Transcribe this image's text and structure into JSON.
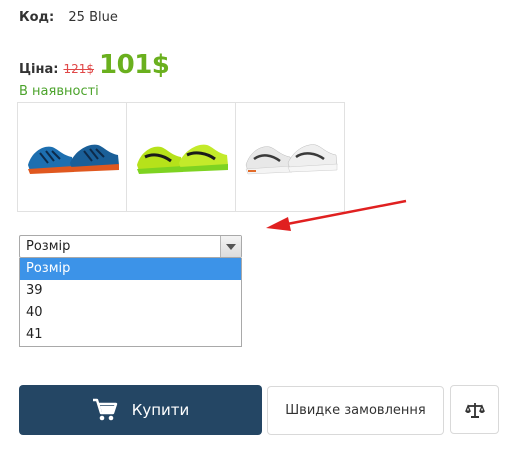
{
  "product": {
    "code_label": "Код:",
    "code_value": "25 Blue",
    "price_label": "Ціна:",
    "old_price": "121$",
    "new_price": "101$",
    "stock_status": "В наявності"
  },
  "thumbnails": [
    {
      "icon": "shoe-blue-orange",
      "colors": {
        "upper": "#1d6fb0",
        "accent": "#0d2a4a",
        "sole": "#e0581f"
      }
    },
    {
      "icon": "shoe-neon-green",
      "colors": {
        "upper": "#b6e21a",
        "accent": "#1a1a1a",
        "sole": "#7ed321"
      }
    },
    {
      "icon": "shoe-white-grey",
      "colors": {
        "upper": "#e8e8e8",
        "accent": "#3a3a3a",
        "sole": "#e26b2a"
      }
    }
  ],
  "size_select": {
    "current_value": "Розмір",
    "options": [
      "Розмір",
      "39",
      "40",
      "41"
    ],
    "highlighted_index": 0
  },
  "actions": {
    "buy_label": "Купити",
    "quick_order_label": "Швидке замовлення"
  },
  "colors": {
    "price_green": "#6ab01e",
    "old_price_red": "#e04848",
    "stock_green": "#4ca32c",
    "buy_button_bg": "#244664",
    "dropdown_highlight": "#3c93e8",
    "annotation_arrow": "#e02020"
  }
}
